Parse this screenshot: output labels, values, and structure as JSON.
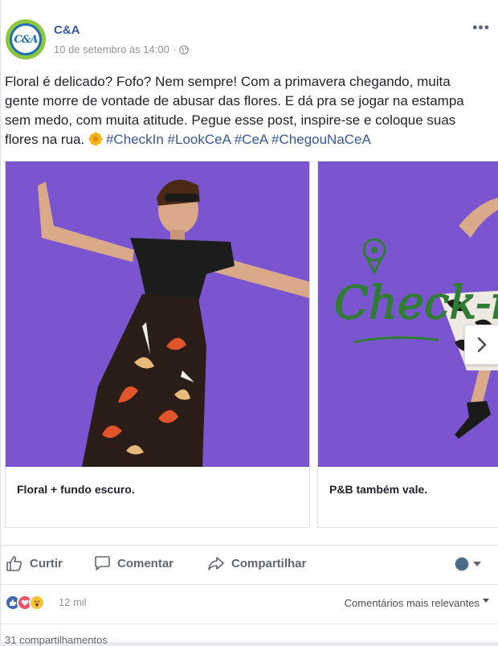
{
  "post": {
    "page_name": "C&A",
    "avatar_logo_text": "C&A",
    "timestamp": "10 de setembro às 14:00",
    "separator": "·",
    "privacy_icon": "globe-icon",
    "more_icon": "more-options-icon",
    "text": "Floral é delicado? Fofo? Nem sempre! Com a primavera chegando, muita gente morre de vontade de abusar das flores. E dá pra se jogar na estampa sem medo, com muita atitude. Pegue esse post, inspire-se e coloque suas flores na rua.",
    "emoji_icon": "flower-emoji-icon",
    "hashtags": [
      "#CheckIn",
      "#LookCeA",
      "#CeA",
      "#ChegouNaCeA"
    ]
  },
  "carousel": {
    "cards": [
      {
        "caption": "Floral + fundo escuro."
      },
      {
        "caption": "P&B também vale."
      }
    ],
    "next_icon": "chevron-right-icon",
    "overlay_text": "Check-in"
  },
  "actions": {
    "like_label": "Curtir",
    "comment_label": "Comentar",
    "share_label": "Compartilhar"
  },
  "reactions": {
    "icons": [
      "like-reaction-icon",
      "love-reaction-icon",
      "wow-reaction-icon"
    ],
    "count": "12 mil",
    "sort_label": "Comentários mais relevantes"
  },
  "shares": {
    "label": "31 compartilhamentos"
  },
  "colors": {
    "link_blue": "#365899",
    "background_purple": "#7a55cf",
    "logo_green": "#8dc63f",
    "logo_blue": "#1f6fb5"
  }
}
